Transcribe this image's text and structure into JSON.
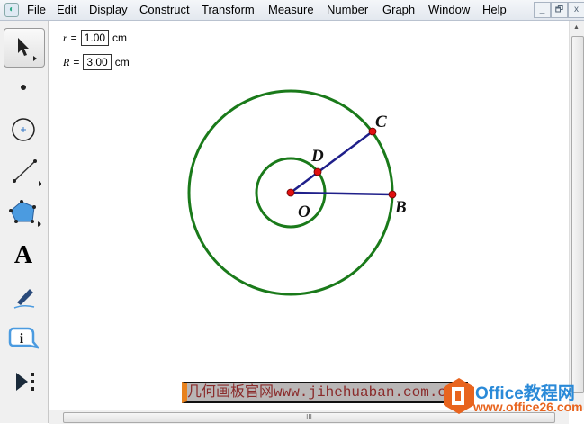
{
  "menu": [
    "File",
    "Edit",
    "Display",
    "Construct",
    "Transform",
    "Measure",
    "Number",
    "Graph",
    "Window",
    "Help"
  ],
  "window_buttons": [
    "_",
    "🗗",
    "x"
  ],
  "measurements": [
    {
      "var": "r",
      "eq": "=",
      "value": "1.00",
      "unit": "cm"
    },
    {
      "var": "R",
      "eq": "=",
      "value": "3.00",
      "unit": "cm"
    }
  ],
  "points": {
    "O": "O",
    "B": "B",
    "C": "C",
    "D": "D"
  },
  "toolbar": {
    "text_tool": "A",
    "info_tool": "i"
  },
  "banner": "几何画板官网www.jihehuaban.com.cn",
  "watermark": {
    "title": "Office教程网",
    "url": "www.office26.com"
  },
  "colors": {
    "circle": "#1a7a1a",
    "segment": "#1f1f8a",
    "point": "#e01010"
  },
  "hscroll_grip": "III"
}
